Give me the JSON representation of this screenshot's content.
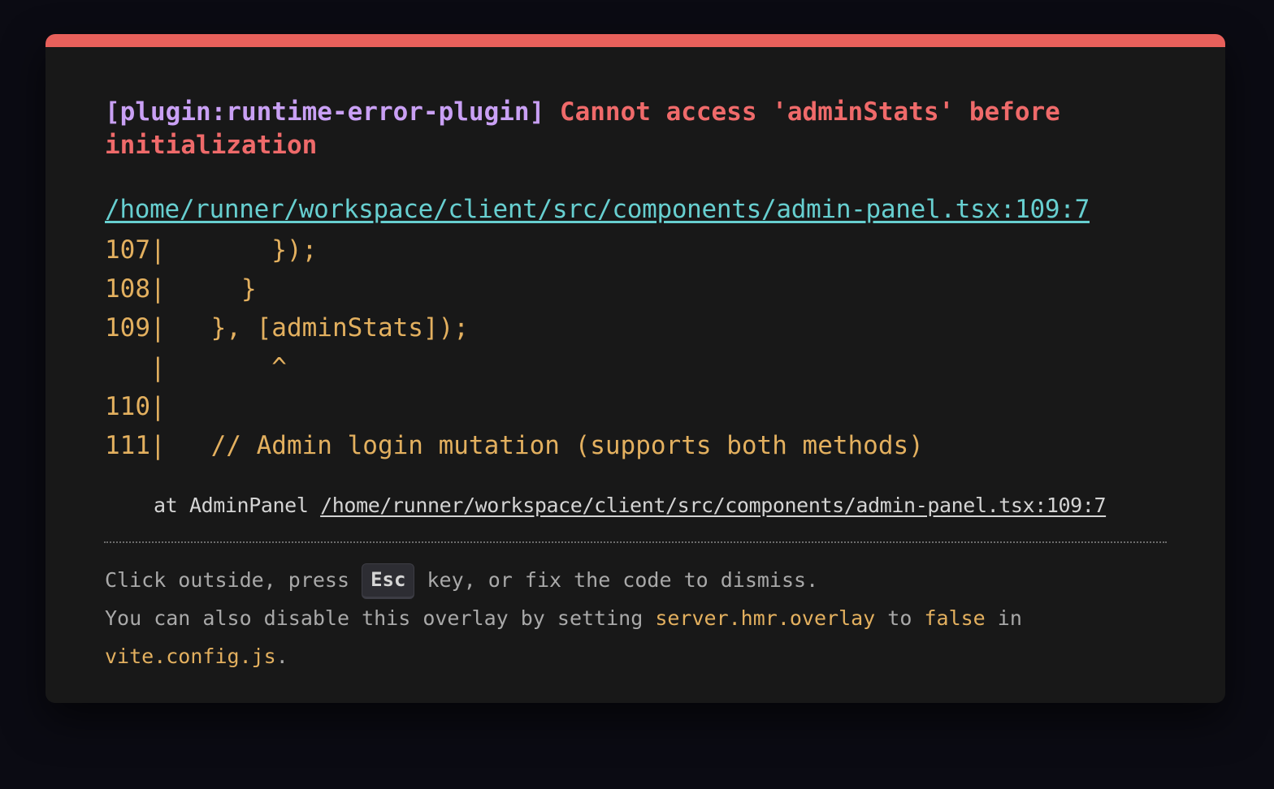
{
  "error": {
    "plugin": "[plugin:runtime-error-plugin]",
    "message": "Cannot access 'adminStats' before initialization",
    "file": "/home/runner/workspace/client/src/components/admin-panel.tsx:109:7"
  },
  "frame": {
    "lines": [
      "107|       });",
      "108|     }",
      "109|   }, [adminStats]);",
      "   |       ^",
      "110|",
      "111|   // Admin login mutation (supports both methods)"
    ]
  },
  "stack": {
    "prefix": "at AdminPanel ",
    "link": "/home/runner/workspace/client/src/components/admin-panel.tsx:109:7"
  },
  "tip": {
    "line1_before": "Click outside, press ",
    "key": "Esc",
    "line1_after": " key, or fix the code to dismiss.",
    "line2_before": "You can also disable this overlay by setting ",
    "setting": "server.hmr.overlay",
    "line2_mid": " to ",
    "value": "false",
    "line2_after": " in",
    "config_file": "vite.config.js",
    "line3_after": "."
  },
  "colors": {
    "accent_bar": "#e8605b",
    "plugin": "#c9a0f4",
    "error": "#ef6a6a",
    "file_link": "#67cfd0",
    "code": "#e3b05f"
  }
}
